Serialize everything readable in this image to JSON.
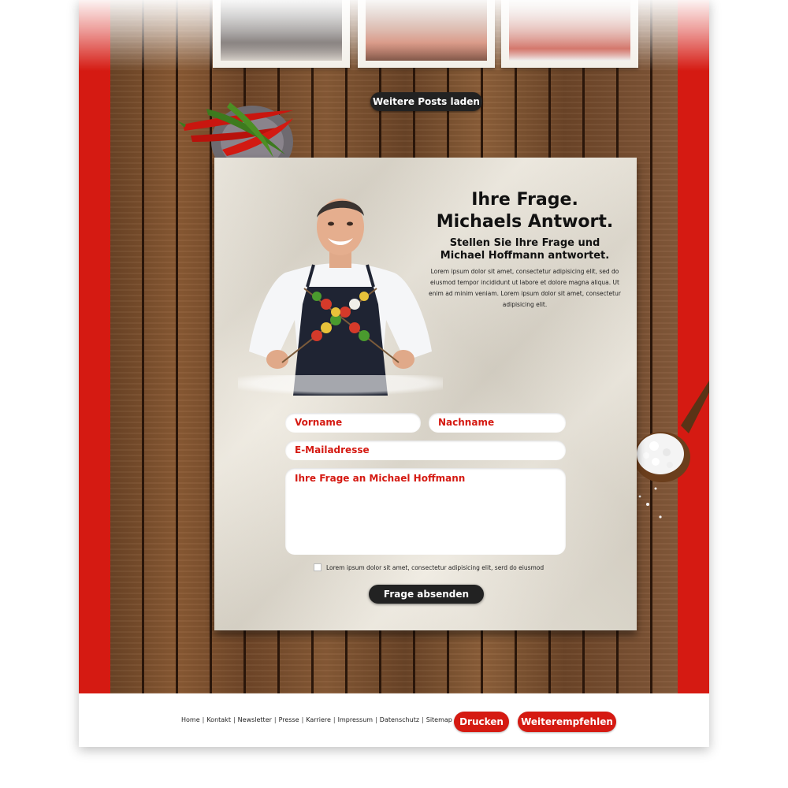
{
  "load_more_label": "Weitere Posts laden",
  "hero": {
    "title_line1": "Ihre Frage.",
    "title_line2": "Michaels Antwort.",
    "subtitle_line1": "Stellen Sie Ihre Frage und",
    "subtitle_line2": "Michael Hoffmann antwortet.",
    "body": "Lorem ipsum dolor sit amet, consectetur adipisicing elit, sed do eiusmod tempor incididunt ut labore et dolore magna aliqua. Ut enim ad minim veniam. Lorem ipsum dolor sit amet, consectetur adipisicing elit."
  },
  "form": {
    "first_name_placeholder": "Vorname",
    "last_name_placeholder": "Nachname",
    "email_placeholder": "E-Mailadresse",
    "question_placeholder": "Ihre Frage an Michael Hoffmann",
    "consent_label": "Lorem ipsum dolor sit amet, consectetur adipisicing elit, serd do eiusmod",
    "submit_label": "Frage absenden"
  },
  "footer": {
    "links": [
      "Home",
      "Kontakt",
      "Newsletter",
      "Presse",
      "Karriere",
      "Impressum",
      "Datenschutz",
      "Sitemap"
    ],
    "print_label": "Drucken",
    "share_label": "Weiterempfehlen"
  },
  "colors": {
    "brand_red": "#d51a12",
    "dark_button": "#222222",
    "paper": "#e9e3d6",
    "wood": "#7a4f2e"
  },
  "icons": [
    "chili-plate-decoration",
    "salt-spoon-decoration",
    "chef-photo"
  ]
}
